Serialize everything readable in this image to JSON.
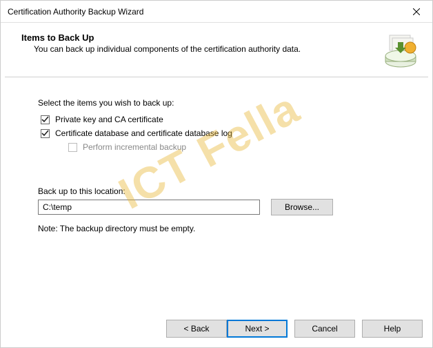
{
  "window": {
    "title": "Certification Authority Backup Wizard"
  },
  "header": {
    "title": "Items to Back Up",
    "subtitle": "You can back up individual components of the certification authority data."
  },
  "form": {
    "select_label": "Select the items you wish to back up:",
    "cb_private_key": "Private key and CA certificate",
    "cb_database": "Certificate database and certificate database log",
    "cb_incremental": "Perform incremental backup",
    "location_label": "Back up to this location:",
    "location_value": "C:\\temp",
    "browse": "Browse...",
    "note": "Note: The backup directory must be empty."
  },
  "buttons": {
    "back": "< Back",
    "next": "Next >",
    "cancel": "Cancel",
    "help": "Help"
  },
  "watermark": "ICT Fella"
}
